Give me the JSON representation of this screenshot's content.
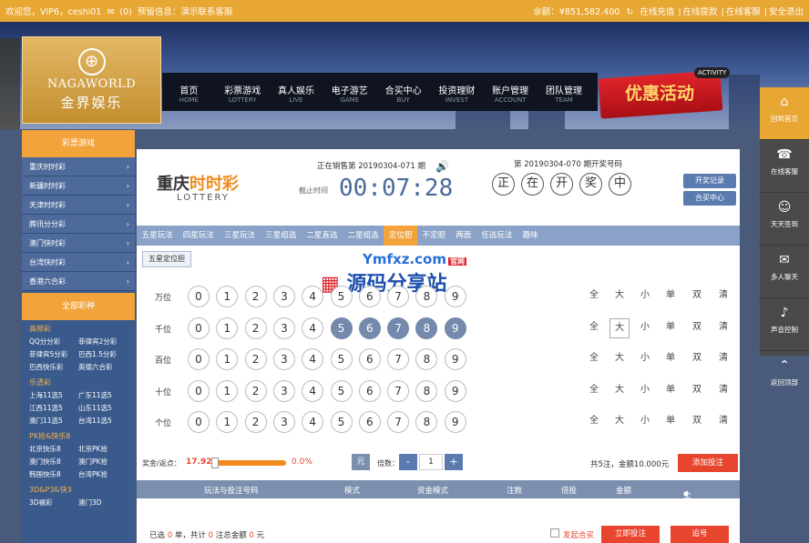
{
  "topbar": {
    "welcome": "欢迎您，VIP6，ceshi01",
    "msg_count": "(0)",
    "notice": "预留信息：演示联系客服",
    "balance_label": "余额：",
    "balance_value": "¥851,582.400",
    "links": [
      "在线充值",
      "在线提款",
      "在线客服",
      "安全退出"
    ]
  },
  "logo": {
    "en": "NAGAWORLD",
    "cn": "金界娱乐"
  },
  "nav": [
    {
      "cn": "首页",
      "en": "HOME"
    },
    {
      "cn": "彩票游戏",
      "en": "LOTTERY"
    },
    {
      "cn": "真人娱乐",
      "en": "LIVE"
    },
    {
      "cn": "电子游艺",
      "en": "GAME"
    },
    {
      "cn": "合买中心",
      "en": "BUY"
    },
    {
      "cn": "投资理财",
      "en": "INVEST"
    },
    {
      "cn": "账户管理",
      "en": "ACCOUNT"
    },
    {
      "cn": "团队管理",
      "en": "TEAM"
    }
  ],
  "promo": {
    "tag": "ACTIVITY",
    "text": "优惠活动"
  },
  "rightbar": [
    "回到首页",
    "在线客服",
    "天天签到",
    "多人聊天",
    "声音控制",
    "返回顶部"
  ],
  "sidebar": {
    "head1": "彩票游戏",
    "items": [
      "重庆时时彩",
      "新疆时时彩",
      "天津时时彩",
      "腾讯分分彩",
      "澳门快时彩",
      "台湾快时彩",
      "香港六合彩"
    ],
    "head2": "全部彩种",
    "groups": [
      {
        "name": "高频彩",
        "items": [
          "QQ分分彩",
          "菲律宾2分彩",
          "菲律宾5分彩",
          "巴西1.5分彩",
          "巴西快乐彩",
          "英德六合彩"
        ]
      },
      {
        "name": "乐透彩",
        "items": [
          "上海11选5",
          "广东11选5",
          "江西11选5",
          "山东11选5",
          "澳门11选5",
          "台湾11选5"
        ]
      },
      {
        "name": "PK拾&快乐8",
        "items": [
          "北京快乐8",
          "北京PK拾",
          "澳门快乐8",
          "澳门PK拾",
          "韩国快乐8",
          "台湾PK拾"
        ]
      },
      {
        "name": "3D&P3&快3",
        "items": [
          "3D福彩",
          "澳门3D"
        ]
      }
    ]
  },
  "lottery": {
    "name_a": "重庆",
    "name_b": "时时彩",
    "name_en": "LOTTERY",
    "sale_text": "正在销售第 20190304-071 期",
    "deadline_label": "截止时间",
    "timer": "00:07:28",
    "draw_text": "第 20190304-070 期开奖号码",
    "draw_balls": [
      "正",
      "在",
      "开",
      "奖",
      "中"
    ],
    "btn_record": "开奖记录",
    "btn_center": "合买中心"
  },
  "tabs": [
    "五星玩法",
    "四星玩法",
    "三星玩法",
    "三星组选",
    "二星直选",
    "二星组选",
    "定位胆",
    "不定胆",
    "两面",
    "任选玩法",
    "趣味"
  ],
  "active_tab": "定位胆",
  "subtab": "五星定位胆",
  "rows": [
    {
      "label": "万位",
      "selected": []
    },
    {
      "label": "千位",
      "selected": [
        5,
        6,
        7,
        8,
        9
      ]
    },
    {
      "label": "百位",
      "selected": []
    },
    {
      "label": "十位",
      "selected": []
    },
    {
      "label": "个位",
      "selected": []
    }
  ],
  "digits": [
    "0",
    "1",
    "2",
    "3",
    "4",
    "5",
    "6",
    "7",
    "8",
    "9"
  ],
  "options": [
    "全",
    "大",
    "小",
    "单",
    "双",
    "清"
  ],
  "option_selected_row": 1,
  "option_selected": "大",
  "bet": {
    "rebate_label": "奖金/返点：",
    "rebate_value": "17.92",
    "percent": "0.0%",
    "unit": "元",
    "multiple_label": "倍数：",
    "minus": "-",
    "multiple": "1",
    "plus": "+",
    "summary": "共5注，金额10.000元",
    "add_btn": "添加投注"
  },
  "table_header": [
    "玩法与投注号码",
    "模式",
    "资金模式",
    "注数",
    "倍投",
    "金额",
    "全删"
  ],
  "footer": {
    "prefix": "已选",
    "count": "0",
    "mid1": "单，共计",
    "total_bets": "0",
    "mid2": "注总金额",
    "amount": "0",
    "suffix": "元",
    "joint": "发起合买",
    "submit": "立即投注",
    "chase": "追号"
  },
  "watermark": {
    "top": "Ymfxz.com",
    "tag": "官网",
    "bottom": "源码分享站"
  },
  "colors": {
    "topbar": "#e8a632",
    "sidebar": "#3a5a8c",
    "accent": "#f2a33a",
    "ball_selected": "#7489ab",
    "button_red": "#e8452f"
  }
}
